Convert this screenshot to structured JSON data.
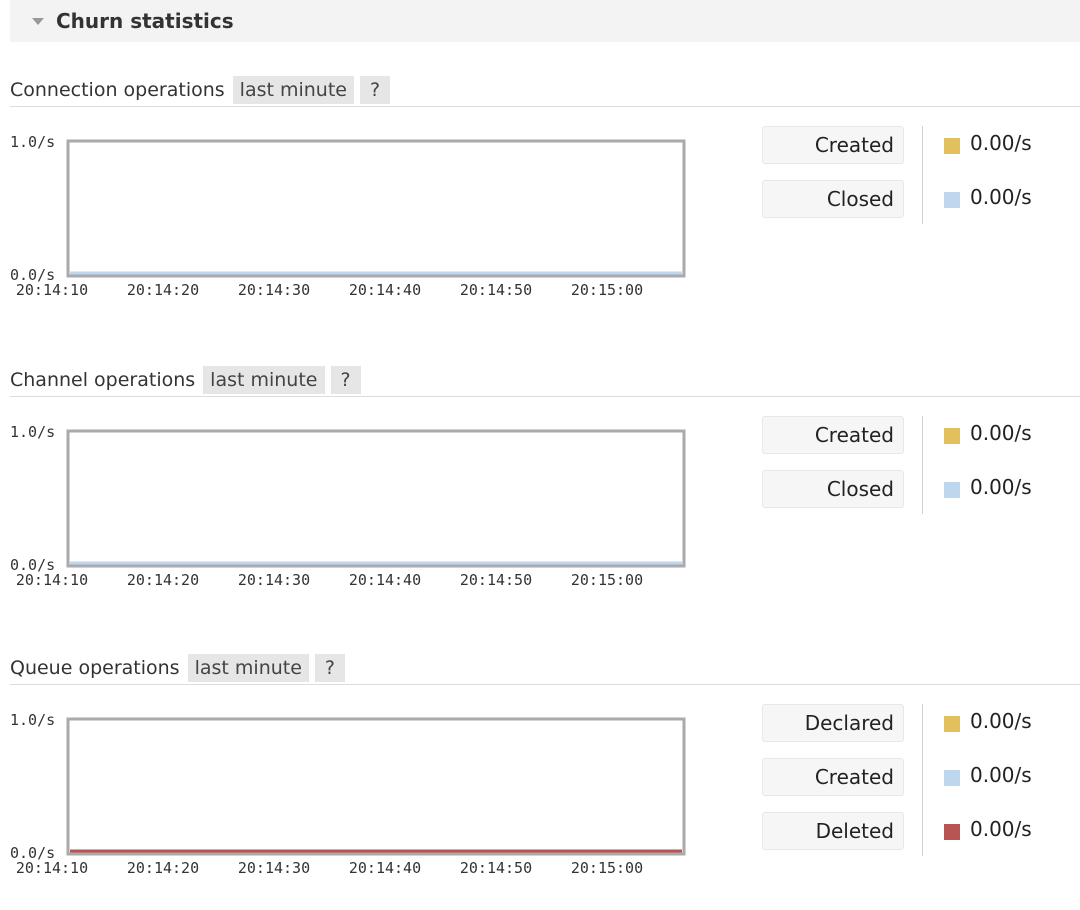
{
  "section": {
    "title": "Churn statistics",
    "collapse_icon": "triangle-down-icon"
  },
  "panels": [
    {
      "heading": "Connection operations",
      "range": "last minute",
      "help": "?",
      "chart_data": {
        "type": "line",
        "x": [
          "20:14:10",
          "20:14:20",
          "20:14:30",
          "20:14:40",
          "20:14:50",
          "20:15:00"
        ],
        "ylim": [
          0,
          1
        ],
        "ytick_labels": [
          "1.0/s",
          "0.0/s"
        ],
        "series": [
          {
            "name": "Created",
            "color": "#e2c05e",
            "values": [
              0,
              0,
              0,
              0,
              0,
              0
            ]
          },
          {
            "name": "Closed",
            "color": "#bed6ee",
            "values": [
              0,
              0,
              0,
              0,
              0,
              0
            ]
          }
        ]
      },
      "legend": [
        {
          "label": "Created",
          "value": "0.00/s",
          "color": "#e2c05e"
        },
        {
          "label": "Closed",
          "value": "0.00/s",
          "color": "#bed6ee"
        }
      ]
    },
    {
      "heading": "Channel operations",
      "range": "last minute",
      "help": "?",
      "chart_data": {
        "type": "line",
        "x": [
          "20:14:10",
          "20:14:20",
          "20:14:30",
          "20:14:40",
          "20:14:50",
          "20:15:00"
        ],
        "ylim": [
          0,
          1
        ],
        "ytick_labels": [
          "1.0/s",
          "0.0/s"
        ],
        "series": [
          {
            "name": "Created",
            "color": "#e2c05e",
            "values": [
              0,
              0,
              0,
              0,
              0,
              0
            ]
          },
          {
            "name": "Closed",
            "color": "#bed6ee",
            "values": [
              0,
              0,
              0,
              0,
              0,
              0
            ]
          }
        ]
      },
      "legend": [
        {
          "label": "Created",
          "value": "0.00/s",
          "color": "#e2c05e"
        },
        {
          "label": "Closed",
          "value": "0.00/s",
          "color": "#bed6ee"
        }
      ]
    },
    {
      "heading": "Queue operations",
      "range": "last minute",
      "help": "?",
      "chart_data": {
        "type": "line",
        "x": [
          "20:14:10",
          "20:14:20",
          "20:14:30",
          "20:14:40",
          "20:14:50",
          "20:15:00"
        ],
        "ylim": [
          0,
          1
        ],
        "ytick_labels": [
          "1.0/s",
          "0.0/s"
        ],
        "series": [
          {
            "name": "Declared",
            "color": "#e2c05e",
            "values": [
              0,
              0,
              0,
              0,
              0,
              0
            ]
          },
          {
            "name": "Created",
            "color": "#bed6ee",
            "values": [
              0,
              0,
              0,
              0,
              0,
              0
            ]
          },
          {
            "name": "Deleted",
            "color": "#b85454",
            "values": [
              0,
              0,
              0,
              0,
              0,
              0
            ]
          }
        ]
      },
      "legend": [
        {
          "label": "Declared",
          "value": "0.00/s",
          "color": "#e2c05e"
        },
        {
          "label": "Created",
          "value": "0.00/s",
          "color": "#bed6ee"
        },
        {
          "label": "Deleted",
          "value": "0.00/s",
          "color": "#b85454"
        }
      ]
    }
  ]
}
